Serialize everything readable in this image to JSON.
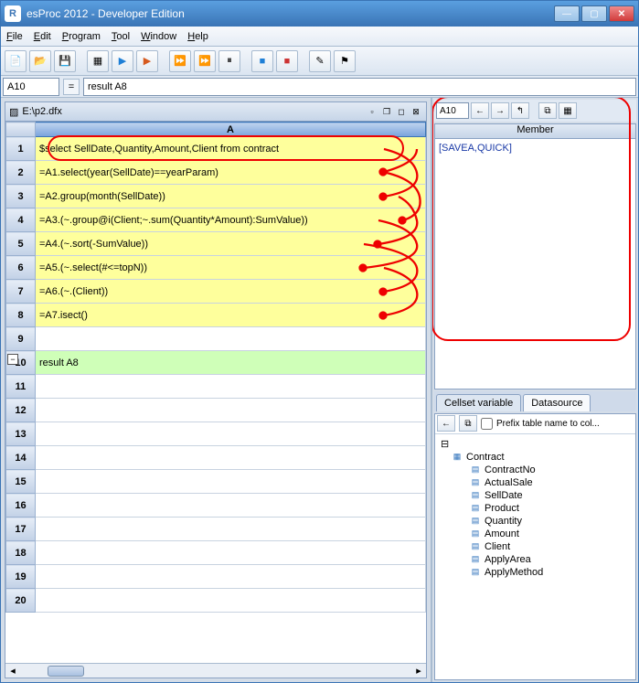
{
  "window": {
    "title": "esProc 2012 - Developer Edition",
    "icon": "R"
  },
  "menu": {
    "file": "File",
    "edit": "Edit",
    "program": "Program",
    "tool": "Tool",
    "window": "Window",
    "help": "Help"
  },
  "formulabar": {
    "cell": "A10",
    "formula": "result A8"
  },
  "doc": {
    "path": "E:\\p2.dfx"
  },
  "columns": {
    "A": "A"
  },
  "rows": [
    {
      "n": "1",
      "t": "$select SellDate,Quantity,Amount,Client from contract",
      "cls": "c-yellow"
    },
    {
      "n": "2",
      "t": "=A1.select(year(SellDate)==yearParam)",
      "cls": "c-yellow"
    },
    {
      "n": "3",
      "t": "=A2.group(month(SellDate))",
      "cls": "c-yellow"
    },
    {
      "n": "4",
      "t": "=A3.(~.group@i(Client;~.sum(Quantity*Amount):SumValue))",
      "cls": "c-yellow"
    },
    {
      "n": "5",
      "t": "=A4.(~.sort(-SumValue))",
      "cls": "c-yellow"
    },
    {
      "n": "6",
      "t": "=A5.(~.select(#<=topN))",
      "cls": "c-yellow"
    },
    {
      "n": "7",
      "t": "=A6.(~.(Client))",
      "cls": "c-yellow"
    },
    {
      "n": "8",
      "t": "=A7.isect()",
      "cls": "c-yellow"
    },
    {
      "n": "9",
      "t": "",
      "cls": ""
    },
    {
      "n": "10",
      "t": "result A8",
      "cls": "c-green"
    },
    {
      "n": "11",
      "t": "",
      "cls": ""
    },
    {
      "n": "12",
      "t": "",
      "cls": ""
    },
    {
      "n": "13",
      "t": "",
      "cls": ""
    },
    {
      "n": "14",
      "t": "",
      "cls": ""
    },
    {
      "n": "15",
      "t": "",
      "cls": ""
    },
    {
      "n": "16",
      "t": "",
      "cls": ""
    },
    {
      "n": "17",
      "t": "",
      "cls": ""
    },
    {
      "n": "18",
      "t": "",
      "cls": ""
    },
    {
      "n": "19",
      "t": "",
      "cls": ""
    },
    {
      "n": "20",
      "t": "",
      "cls": ""
    }
  ],
  "right": {
    "cell": "A10",
    "memberHeader": "Member",
    "memberValue": "[SAVEA,QUICK]"
  },
  "tabs": {
    "cellset": "Cellset variable",
    "datasource": "Datasource"
  },
  "ds": {
    "prefix": "Prefix table name to col...",
    "root": "Contract",
    "fields": [
      "ContractNo",
      "ActualSale",
      "SellDate",
      "Product",
      "Quantity",
      "Amount",
      "Client",
      "ApplyArea",
      "ApplyMethod"
    ]
  }
}
